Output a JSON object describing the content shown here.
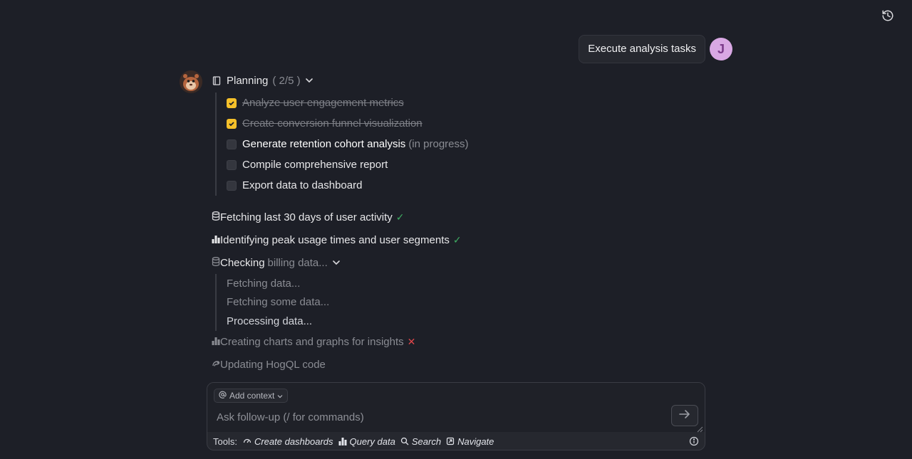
{
  "user_message": {
    "text": "Execute analysis tasks",
    "avatar_initial": "J"
  },
  "planning": {
    "label": "Planning",
    "count": "( 2/5 )",
    "tasks": [
      {
        "text": "Analyze user engagement metrics",
        "status": "done"
      },
      {
        "text": "Create conversion funnel visualization",
        "status": "done"
      },
      {
        "text": "Generate retention cohort analysis",
        "status": "in_progress",
        "note": "(in progress)"
      },
      {
        "text": "Compile comprehensive report",
        "status": "pending"
      },
      {
        "text": "Export data to dashboard",
        "status": "pending"
      }
    ]
  },
  "steps": [
    {
      "text": "Fetching last 30 days of user activity",
      "icon": "database-icon",
      "status": "success"
    },
    {
      "text": "Identifying peak usage times and user segments",
      "icon": "bar-chart-icon",
      "status": "success"
    },
    {
      "label": "Checking",
      "detail": "billing data...",
      "icon": "database-icon",
      "status": "running",
      "substeps": [
        "Fetching data...",
        "Fetching some data...",
        "Processing data..."
      ]
    },
    {
      "text": "Creating charts and graphs for insights",
      "icon": "bar-chart-icon",
      "status": "failed"
    },
    {
      "text": "Updating HogQL code",
      "icon": "hog-icon",
      "status": "pending"
    }
  ],
  "composer": {
    "add_context_label": "Add context",
    "placeholder": "Ask follow-up (/ for commands)",
    "tools_label": "Tools:",
    "tools": [
      "Create dashboards",
      "Query data",
      "Search",
      "Navigate"
    ]
  },
  "colors": {
    "accent_checkbox": "#f5c02a",
    "success": "#3fae63",
    "error": "#e0464a",
    "avatar_bg": "#d9a8e4"
  }
}
